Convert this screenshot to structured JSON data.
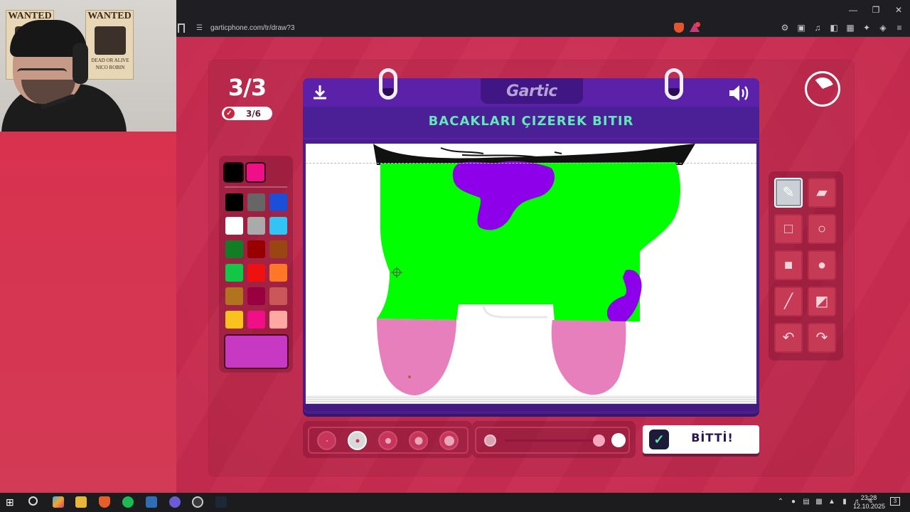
{
  "browser": {
    "url": "garticphone.com/tr/draw?3"
  },
  "game": {
    "round": "3/3",
    "progress": "3/6",
    "logo": "Gartic",
    "prompt": "BACAKLARI ÇIZEREK BITIR",
    "done_button": "BİTTİ!",
    "timer_elapsed_fraction": 0.7
  },
  "palette": {
    "current": [
      "#000000",
      "#f00f86"
    ],
    "colors": [
      "#000000",
      "#666666",
      "#1c4fd8",
      "#ffffff",
      "#aaaaaa",
      "#33c4f6",
      "#117e26",
      "#980000",
      "#9a4613",
      "#12c748",
      "#ef1010",
      "#ff7828",
      "#b2731f",
      "#98003f",
      "#cb5858",
      "#fac21e",
      "#f00f86",
      "#fea8a3"
    ],
    "selected": "#c739c2"
  },
  "tools": [
    {
      "name": "pencil-tool",
      "icon": "pencil-icon",
      "active": true
    },
    {
      "name": "eraser-tool",
      "icon": "eraser-icon",
      "active": false
    },
    {
      "name": "rectangle-outline-tool",
      "icon": "square-outline-icon",
      "active": false
    },
    {
      "name": "ellipse-outline-tool",
      "icon": "circle-outline-icon",
      "active": false
    },
    {
      "name": "rectangle-fill-tool",
      "icon": "square-fill-icon",
      "active": false
    },
    {
      "name": "ellipse-fill-tool",
      "icon": "circle-fill-icon",
      "active": false
    },
    {
      "name": "line-tool",
      "icon": "line-icon",
      "active": false
    },
    {
      "name": "fill-bucket-tool",
      "icon": "bucket-icon",
      "active": false
    },
    {
      "name": "undo-tool",
      "icon": "undo-icon",
      "active": false
    },
    {
      "name": "redo-tool",
      "icon": "redo-icon",
      "active": false
    }
  ],
  "brush": {
    "sizes": 5,
    "selected_size_index": 1,
    "opacity_fraction": 0.92
  },
  "taskbar": {
    "time": "23:28",
    "date": "12.10.2025",
    "notification_count": "3"
  }
}
